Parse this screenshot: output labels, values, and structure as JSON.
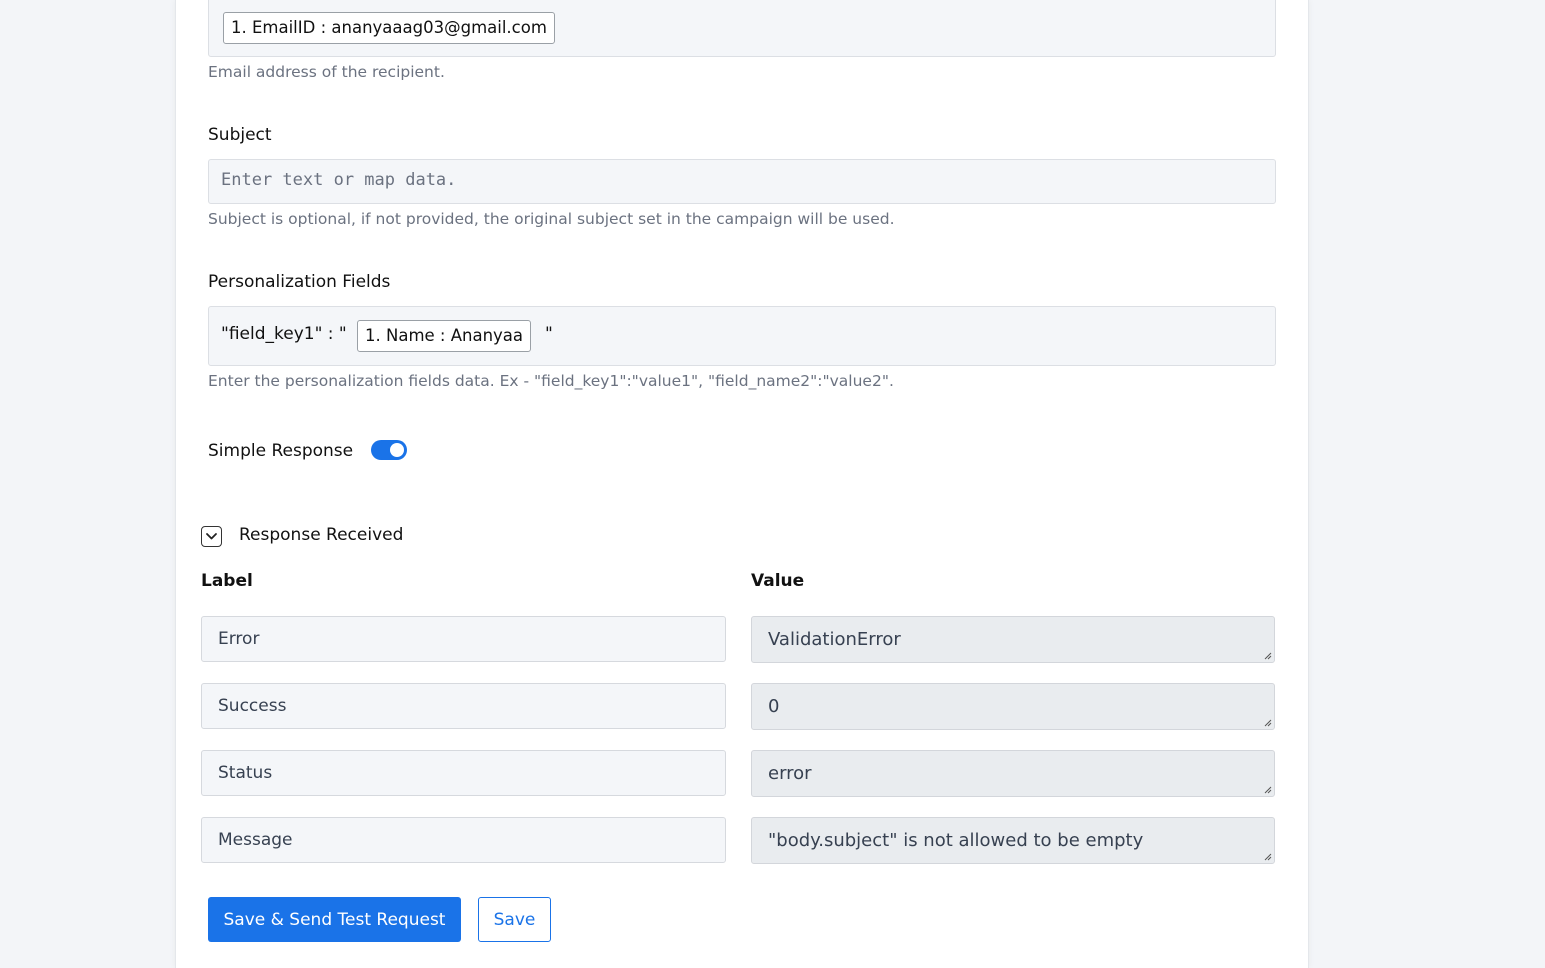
{
  "recipient": {
    "chip": "1. EmailID : ananyaaag03@gmail.com",
    "help": "Email address of the recipient."
  },
  "subject": {
    "label": "Subject",
    "placeholder": "Enter text or map data.",
    "help": "Subject is optional, if not provided, the original subject set in the campaign will be used."
  },
  "personalization": {
    "label": "Personalization Fields",
    "prefix": "\"field_key1\" : \"",
    "chip": "1. Name : Ananyaa",
    "suffix": "\"",
    "help": "Enter the personalization fields data. Ex - \"field_key1\":\"value1\", \"field_name2\":\"value2\"."
  },
  "simple_response": {
    "label": "Simple Response",
    "enabled": true
  },
  "response": {
    "title": "Response Received",
    "label_header": "Label",
    "value_header": "Value",
    "rows": [
      {
        "label": "Error",
        "value": "ValidationError"
      },
      {
        "label": "Success",
        "value": "0"
      },
      {
        "label": "Status",
        "value": "error"
      },
      {
        "label": "Message",
        "value": "\"body.subject\" is not allowed to be empty"
      }
    ]
  },
  "buttons": {
    "save_send": "Save & Send Test Request",
    "save": "Save"
  },
  "colors": {
    "accent": "#1a73e8",
    "background": "#f3f5f8",
    "field": "#f4f6f9"
  }
}
